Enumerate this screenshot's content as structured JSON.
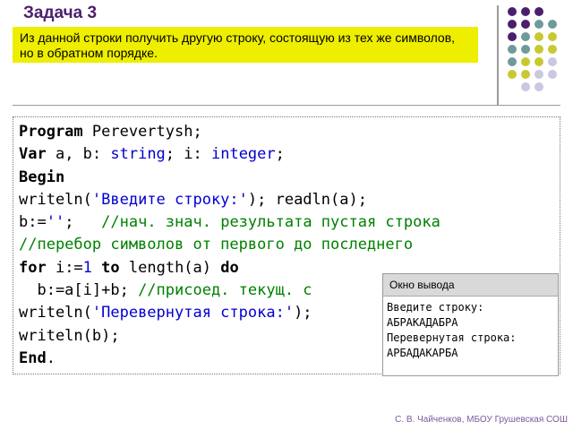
{
  "slide": {
    "title": "Задача 3",
    "task_text": "Из данной строки получить другую строку, состоящую из тех же символов, но в обратном порядке.",
    "footer": "С. В. Чайченков, МБОУ Грушевская СОШ"
  },
  "colors": {
    "title": "#4b1f6e",
    "task_background": "#eeee00",
    "keyword": "#000000",
    "type": "#0000d0",
    "string": "#0000d0",
    "comment": "#008000",
    "dot_purple": "#4b1f6e",
    "dot_teal": "#6f9a9a",
    "dot_yellow": "#c8c830",
    "dot_lavender": "#c8c8e0"
  },
  "code": {
    "l1_kw": "Program",
    "l1_rest": " Perevertysh;",
    "l2_kw": "Var",
    "l2_a": " a, b: ",
    "l2_type1": "string",
    "l2_b": "; i: ",
    "l2_type2": "integer",
    "l2_c": ";",
    "l3_kw": "Begin",
    "l4_a": "writeln(",
    "l4_str": "'Введите строку:'",
    "l4_b": "); readln(a);",
    "l5_a": "b:=",
    "l5_str": "''",
    "l5_b": ";   ",
    "l5_comment": "//нач. знач. результата пустая строка",
    "l6_comment": "//перебор символов от первого до последнего",
    "l7_kw1": "for",
    "l7_a": " i:=",
    "l7_num": "1",
    "l7_b": " ",
    "l7_kw2": "to",
    "l7_c": " length(a) ",
    "l7_kw3": "do",
    "l8_a": "  b:=a[i]+b; ",
    "l8_comment": "//присоед. текущ. с",
    "l9_a": "writeln(",
    "l9_str": "'Перевернутая строка:'",
    "l9_b": ");",
    "l10": "writeln(b);",
    "l11_kw": "End",
    "l11_rest": "."
  },
  "output_window": {
    "title": "Окно вывода",
    "lines": [
      "Введите строку:",
      "АБРАКАДАБРА",
      "Перевернутая строка:",
      "АРБАДАКАРБА"
    ]
  }
}
